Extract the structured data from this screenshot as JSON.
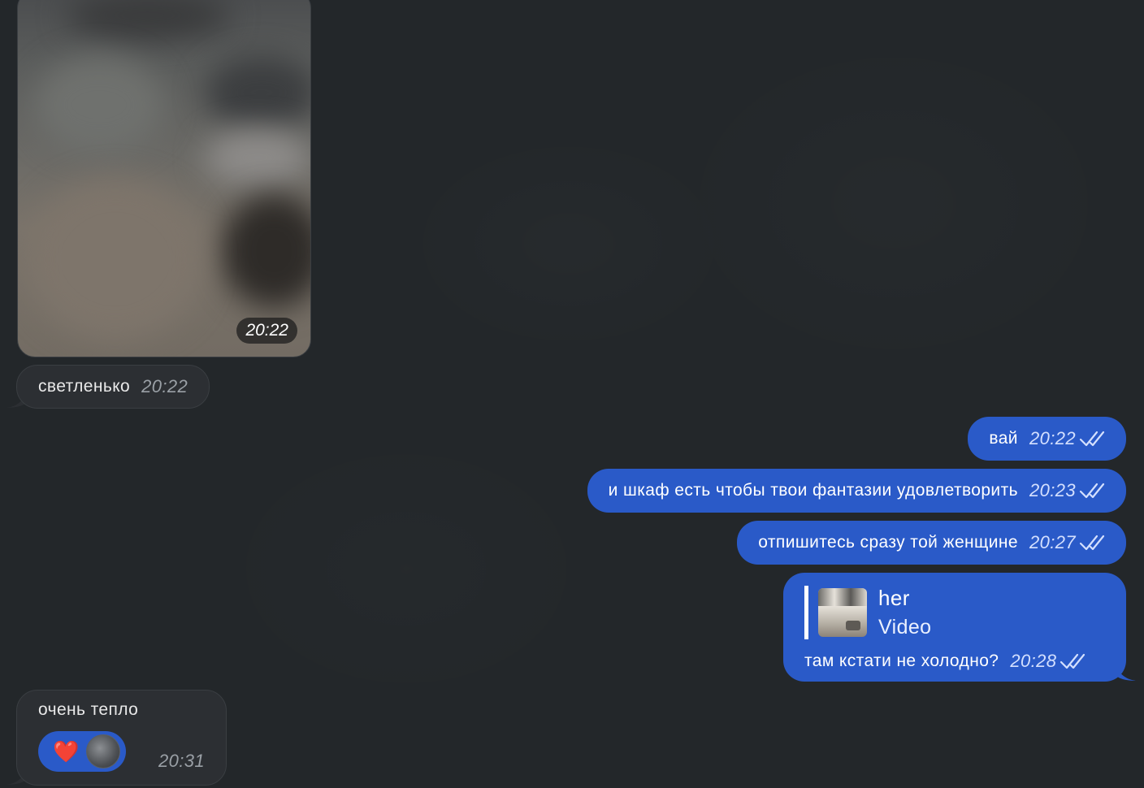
{
  "incoming": {
    "media_time": "20:22",
    "msg1": {
      "text": "светленько",
      "time": "20:22"
    },
    "msg_last": {
      "text": "очень тепло",
      "time": "20:31",
      "reaction_emoji": "❤️"
    }
  },
  "outgoing": [
    {
      "text": "вай",
      "time": "20:22"
    },
    {
      "text": "и шкаф есть чтобы твои фантазии удовлетворить",
      "time": "20:23"
    },
    {
      "text": "отпишитесь сразу той женщине",
      "time": "20:27"
    },
    {
      "reply_name": "her",
      "reply_kind": "Video",
      "text": "там кстати не холодно?",
      "time": "20:28"
    }
  ],
  "colors": {
    "background": "#23272a",
    "incoming_bubble": "#2c2f33",
    "outgoing_bubble": "#2a5ac8"
  },
  "icons": {
    "read_status": "double-check-icon",
    "tail": "bubble-tail"
  }
}
